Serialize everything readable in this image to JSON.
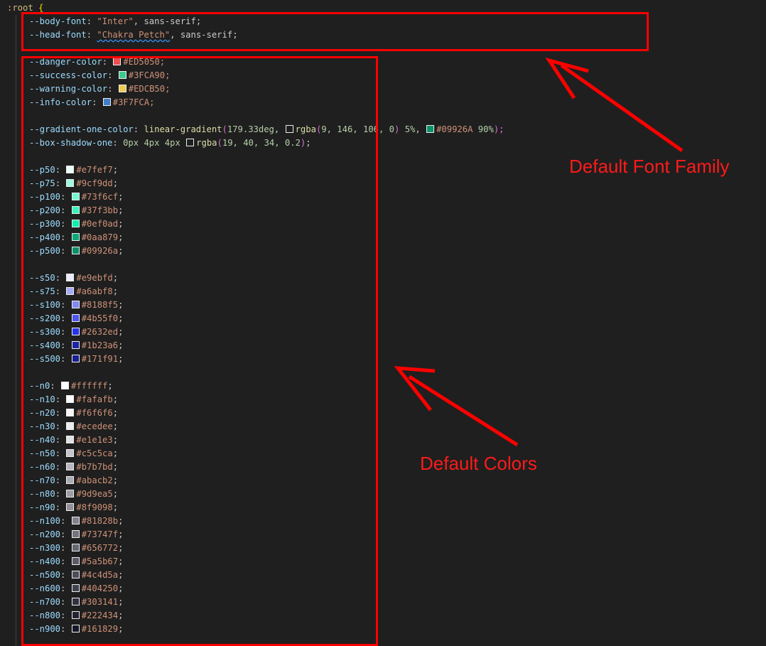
{
  "selector": ":root",
  "open_brace": "{",
  "font_vars": [
    {
      "name": "--body-font",
      "value_quoted": "\"Inter\"",
      "value_rest": ", sans-serif;"
    },
    {
      "name": "--head-font",
      "value_quoted": "\"Chakra Petch\"",
      "value_rest": ", sans-serif;"
    }
  ],
  "status_colors": [
    {
      "name": "--danger-color",
      "swatch": "#ED5050",
      "hex": "#ED5050;"
    },
    {
      "name": "--success-color",
      "swatch": "#3FCA90",
      "hex": "#3FCA90;"
    },
    {
      "name": "--warning-color",
      "swatch": "#EDCB50",
      "hex": "#EDCB50;"
    },
    {
      "name": "--info-color",
      "swatch": "#3F7FCA",
      "hex": "#3F7FCA;"
    }
  ],
  "gradient": {
    "name": "--gradient-one-color",
    "fn": "linear-gradient",
    "angle": "179.33deg",
    "rgba_fn": "rgba",
    "rgba_args": "9, 146, 106, 0",
    "stop1": "5%",
    "color2": "#09926A",
    "stop2": "90%",
    "end": ");"
  },
  "shadow": {
    "name": "--box-shadow-one",
    "offsets": "0px 4px 4px",
    "rgba_fn": "rgba",
    "rgba_args": "19, 40, 34, 0.2",
    "end": ";"
  },
  "primary": [
    {
      "name": "--p50",
      "hex": "#e7fef7"
    },
    {
      "name": "--p75",
      "hex": "#9cf9dd"
    },
    {
      "name": "--p100",
      "hex": "#73f6cf"
    },
    {
      "name": "--p200",
      "hex": "#37f3bb"
    },
    {
      "name": "--p300",
      "hex": "#0ef0ad"
    },
    {
      "name": "--p400",
      "hex": "#0aa879"
    },
    {
      "name": "--p500",
      "hex": "#09926a"
    }
  ],
  "secondary": [
    {
      "name": "--s50",
      "hex": "#e9ebfd"
    },
    {
      "name": "--s75",
      "hex": "#a6abf8"
    },
    {
      "name": "--s100",
      "hex": "#8188f5"
    },
    {
      "name": "--s200",
      "hex": "#4b55f0"
    },
    {
      "name": "--s300",
      "hex": "#2632ed"
    },
    {
      "name": "--s400",
      "hex": "#1b23a6"
    },
    {
      "name": "--s500",
      "hex": "#171f91"
    }
  ],
  "neutral": [
    {
      "name": "--n0",
      "hex": "#ffffff"
    },
    {
      "name": "--n10",
      "hex": "#fafafb"
    },
    {
      "name": "--n20",
      "hex": "#f6f6f6"
    },
    {
      "name": "--n30",
      "hex": "#ecedee"
    },
    {
      "name": "--n40",
      "hex": "#e1e1e3"
    },
    {
      "name": "--n50",
      "hex": "#c5c5ca"
    },
    {
      "name": "--n60",
      "hex": "#b7b7bd"
    },
    {
      "name": "--n70",
      "hex": "#abacb2"
    },
    {
      "name": "--n80",
      "hex": "#9d9ea5"
    },
    {
      "name": "--n90",
      "hex": "#8f9098"
    },
    {
      "name": "--n100",
      "hex": "#81828b"
    },
    {
      "name": "--n200",
      "hex": "#73747f"
    },
    {
      "name": "--n300",
      "hex": "#656772"
    },
    {
      "name": "--n400",
      "hex": "#5a5b67"
    },
    {
      "name": "--n500",
      "hex": "#4c4d5a"
    },
    {
      "name": "--n600",
      "hex": "#404250"
    },
    {
      "name": "--n700",
      "hex": "#303141"
    },
    {
      "name": "--n800",
      "hex": "#222434"
    },
    {
      "name": "--n900",
      "hex": "#161829"
    }
  ],
  "annotations": {
    "font_label": "Default Font Family",
    "colors_label": "Default Colors",
    "color": "#ff0000"
  }
}
